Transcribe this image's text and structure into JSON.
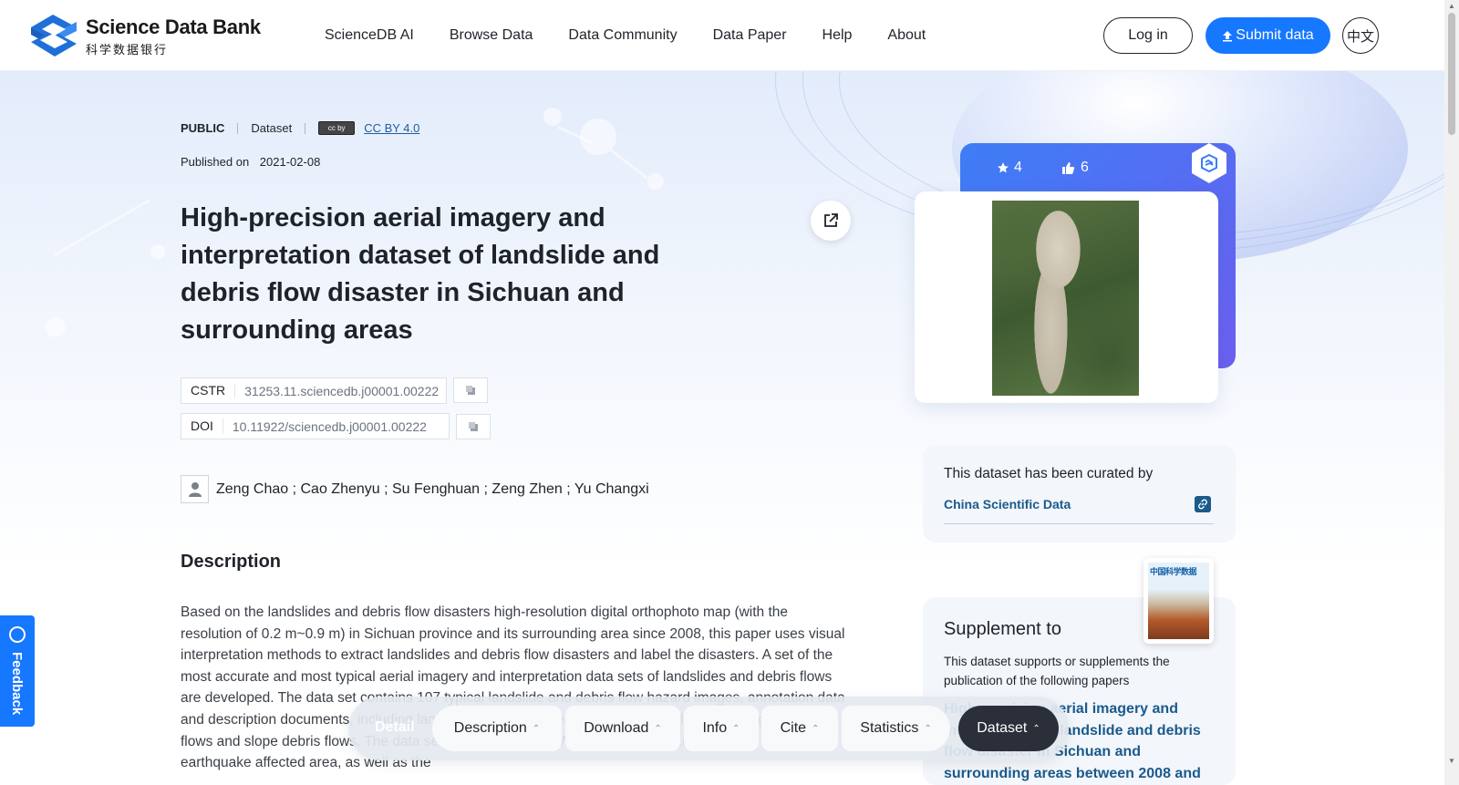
{
  "header": {
    "logo_en": "Science Data Bank",
    "logo_cn": "科学数据银行",
    "nav": [
      "ScienceDB AI",
      "Browse Data",
      "Data Community",
      "Data Paper",
      "Help",
      "About"
    ],
    "login": "Log in",
    "submit": "Submit data",
    "lang": "中文"
  },
  "meta": {
    "access": "PUBLIC",
    "type": "Dataset",
    "license_badge": "cc by",
    "license": "CC BY 4.0",
    "published_label": "Published on",
    "published_date": "2021-02-08"
  },
  "title": "High-precision aerial imagery and interpretation dataset of landslide and debris flow disaster in Sichuan and surrounding areas",
  "identifiers": {
    "cstr_label": "CSTR",
    "cstr": "31253.11.sciencedb.j00001.00222",
    "doi_label": "DOI",
    "doi": "10.11922/sciencedb.j00001.00222"
  },
  "authors": "Zeng Chao ; Cao Zhenyu ; Su Fenghuan ; Zeng Zhen ; Yu Changxi",
  "description": {
    "heading": "Description",
    "text": "Based on the landslides and debris flow disasters high-resolution digital orthophoto map (with the resolution of 0.2 m~0.9 m) in Sichuan province and its surrounding area since 2008, this paper uses visual interpretation methods to extract landslides and debris flow disasters and label the disasters. A set of the most accurate and most typical aerial imagery and interpretation data sets of landslides and debris flows are developed. The data set contains 107 typical landslide and debris flow hazard images, annotation data and description documents, including landslides induced by earthquakes, rainfall landslides, gully debris flows and slope debris flows. The data set covers the “5·12” Wenchuan, “4·20” Lushan, “8·8” Jiuzhaigou earthquake affected area, as well as the"
  },
  "stats": {
    "stars": "4",
    "likes": "6"
  },
  "curated": {
    "text": "This dataset has been curated by",
    "org": "China Scientific Data"
  },
  "supplement": {
    "title": "Supplement to",
    "desc": "This dataset supports or supplements the publication of the following papers",
    "paper": "High-precision aerial imagery and interpretation of landslide and debris flow disaster in Sichuan and surrounding areas between 2008 and",
    "journal_cover_title": "中国科学数据"
  },
  "feedback": "Feedback",
  "detail_bar": {
    "lead": "Detail",
    "tabs": [
      "Description",
      "Download",
      "Info",
      "Cite",
      "Statistics",
      "Dataset"
    ],
    "active": "Dataset"
  },
  "colors": {
    "primary": "#1677ff",
    "link": "#1a5a8c",
    "active_tab": "#2b2f3a"
  }
}
